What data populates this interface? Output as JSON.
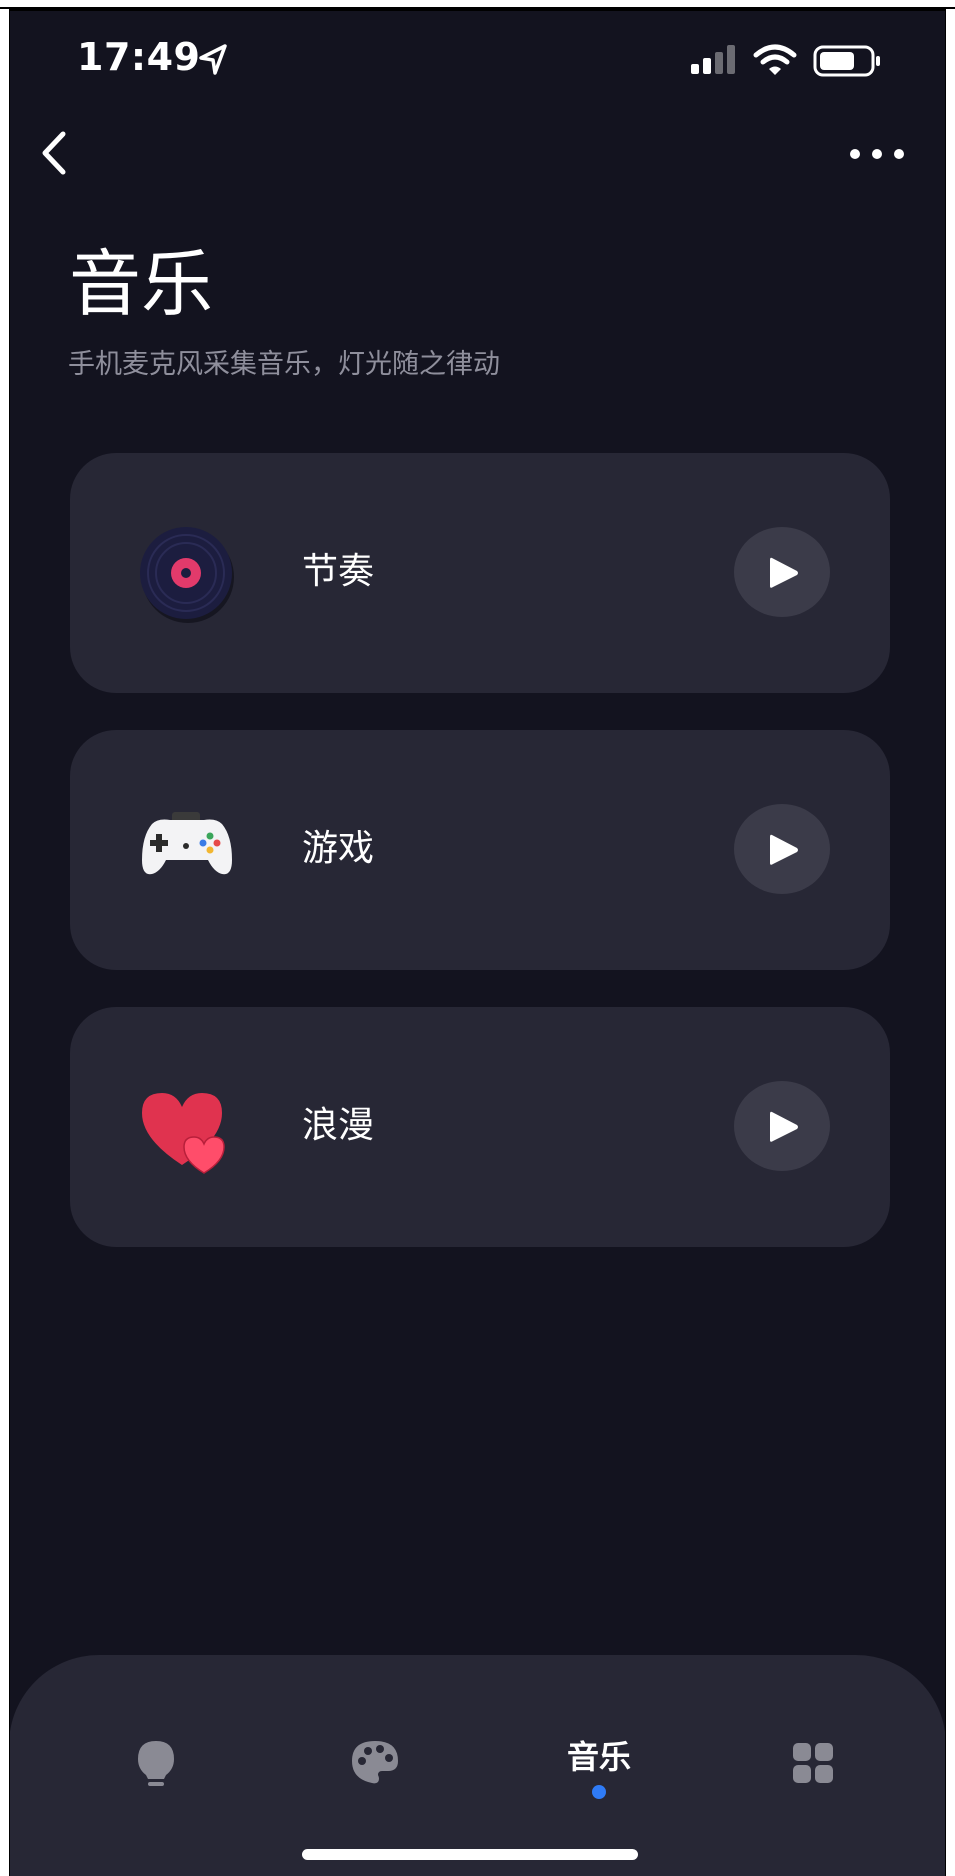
{
  "status_bar": {
    "time": "17:49"
  },
  "header": {
    "title": "音乐",
    "subtitle": "手机麦克风采集音乐，灯光随之律动"
  },
  "cards": [
    {
      "label": "节奏",
      "icon": "vinyl-record-icon"
    },
    {
      "label": "游戏",
      "icon": "game-controller-icon"
    },
    {
      "label": "浪漫",
      "icon": "hearts-icon"
    }
  ],
  "tabbar": {
    "items": [
      {
        "icon": "lightbulb-icon",
        "label": ""
      },
      {
        "icon": "palette-icon",
        "label": ""
      },
      {
        "icon": "",
        "label": "音乐",
        "active": true
      },
      {
        "icon": "grid-icon",
        "label": ""
      }
    ]
  },
  "colors": {
    "background": "#13131f",
    "card": "#272735",
    "play_button": "#3b3b49",
    "accent_dot": "#2f7bf6",
    "subtitle_text": "#8f8f9c"
  }
}
